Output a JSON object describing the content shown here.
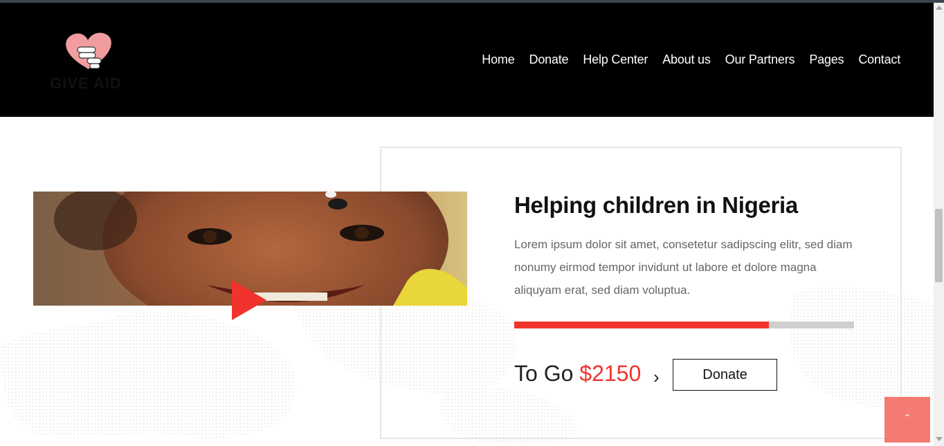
{
  "header": {
    "logo_text": "GIVE AID",
    "nav": [
      "Home",
      "Donate",
      "Help Center",
      "About us",
      "Our Partners",
      "Pages",
      "Contact"
    ]
  },
  "cause": {
    "title": "Helping children in Nigeria",
    "description": "Lorem ipsum dolor sit amet, consetetur sadipscing elitr, sed diam nonumy eirmod tempor invidunt ut labore et dolore magna aliquyam erat, sed diam voluptua.",
    "progress_percent": 75,
    "to_go_label": "To Go",
    "amount": "$2150",
    "donate_label": "Donate"
  },
  "icons": {
    "play": "play-icon",
    "chevron": "chevron-right-icon",
    "back_to_top": "chevron-up-icon"
  },
  "colors": {
    "accent": "#f0342d",
    "back_to_top_bg": "#f57a72",
    "nav_bg": "#000000"
  }
}
